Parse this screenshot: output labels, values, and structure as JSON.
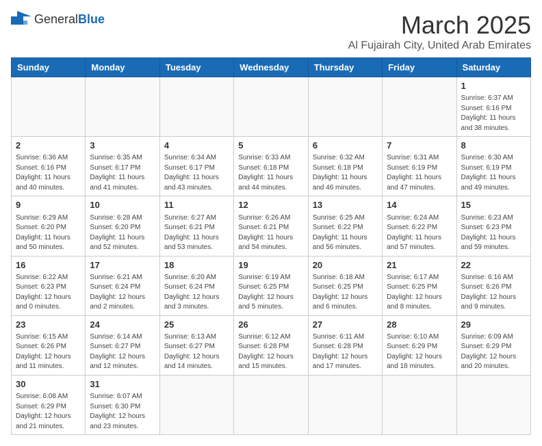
{
  "header": {
    "logo_general": "General",
    "logo_blue": "Blue",
    "title": "March 2025",
    "subtitle": "Al Fujairah City, United Arab Emirates"
  },
  "weekdays": [
    "Sunday",
    "Monday",
    "Tuesday",
    "Wednesday",
    "Thursday",
    "Friday",
    "Saturday"
  ],
  "weeks": [
    [
      {
        "day": "",
        "info": ""
      },
      {
        "day": "",
        "info": ""
      },
      {
        "day": "",
        "info": ""
      },
      {
        "day": "",
        "info": ""
      },
      {
        "day": "",
        "info": ""
      },
      {
        "day": "",
        "info": ""
      },
      {
        "day": "1",
        "info": "Sunrise: 6:37 AM\nSunset: 6:16 PM\nDaylight: 11 hours\nand 38 minutes."
      }
    ],
    [
      {
        "day": "2",
        "info": "Sunrise: 6:36 AM\nSunset: 6:16 PM\nDaylight: 11 hours\nand 40 minutes."
      },
      {
        "day": "3",
        "info": "Sunrise: 6:35 AM\nSunset: 6:17 PM\nDaylight: 11 hours\nand 41 minutes."
      },
      {
        "day": "4",
        "info": "Sunrise: 6:34 AM\nSunset: 6:17 PM\nDaylight: 11 hours\nand 43 minutes."
      },
      {
        "day": "5",
        "info": "Sunrise: 6:33 AM\nSunset: 6:18 PM\nDaylight: 11 hours\nand 44 minutes."
      },
      {
        "day": "6",
        "info": "Sunrise: 6:32 AM\nSunset: 6:18 PM\nDaylight: 11 hours\nand 46 minutes."
      },
      {
        "day": "7",
        "info": "Sunrise: 6:31 AM\nSunset: 6:19 PM\nDaylight: 11 hours\nand 47 minutes."
      },
      {
        "day": "8",
        "info": "Sunrise: 6:30 AM\nSunset: 6:19 PM\nDaylight: 11 hours\nand 49 minutes."
      }
    ],
    [
      {
        "day": "9",
        "info": "Sunrise: 6:29 AM\nSunset: 6:20 PM\nDaylight: 11 hours\nand 50 minutes."
      },
      {
        "day": "10",
        "info": "Sunrise: 6:28 AM\nSunset: 6:20 PM\nDaylight: 11 hours\nand 52 minutes."
      },
      {
        "day": "11",
        "info": "Sunrise: 6:27 AM\nSunset: 6:21 PM\nDaylight: 11 hours\nand 53 minutes."
      },
      {
        "day": "12",
        "info": "Sunrise: 6:26 AM\nSunset: 6:21 PM\nDaylight: 11 hours\nand 54 minutes."
      },
      {
        "day": "13",
        "info": "Sunrise: 6:25 AM\nSunset: 6:22 PM\nDaylight: 11 hours\nand 56 minutes."
      },
      {
        "day": "14",
        "info": "Sunrise: 6:24 AM\nSunset: 6:22 PM\nDaylight: 11 hours\nand 57 minutes."
      },
      {
        "day": "15",
        "info": "Sunrise: 6:23 AM\nSunset: 6:23 PM\nDaylight: 11 hours\nand 59 minutes."
      }
    ],
    [
      {
        "day": "16",
        "info": "Sunrise: 6:22 AM\nSunset: 6:23 PM\nDaylight: 12 hours\nand 0 minutes."
      },
      {
        "day": "17",
        "info": "Sunrise: 6:21 AM\nSunset: 6:24 PM\nDaylight: 12 hours\nand 2 minutes."
      },
      {
        "day": "18",
        "info": "Sunrise: 6:20 AM\nSunset: 6:24 PM\nDaylight: 12 hours\nand 3 minutes."
      },
      {
        "day": "19",
        "info": "Sunrise: 6:19 AM\nSunset: 6:25 PM\nDaylight: 12 hours\nand 5 minutes."
      },
      {
        "day": "20",
        "info": "Sunrise: 6:18 AM\nSunset: 6:25 PM\nDaylight: 12 hours\nand 6 minutes."
      },
      {
        "day": "21",
        "info": "Sunrise: 6:17 AM\nSunset: 6:25 PM\nDaylight: 12 hours\nand 8 minutes."
      },
      {
        "day": "22",
        "info": "Sunrise: 6:16 AM\nSunset: 6:26 PM\nDaylight: 12 hours\nand 9 minutes."
      }
    ],
    [
      {
        "day": "23",
        "info": "Sunrise: 6:15 AM\nSunset: 6:26 PM\nDaylight: 12 hours\nand 11 minutes."
      },
      {
        "day": "24",
        "info": "Sunrise: 6:14 AM\nSunset: 6:27 PM\nDaylight: 12 hours\nand 12 minutes."
      },
      {
        "day": "25",
        "info": "Sunrise: 6:13 AM\nSunset: 6:27 PM\nDaylight: 12 hours\nand 14 minutes."
      },
      {
        "day": "26",
        "info": "Sunrise: 6:12 AM\nSunset: 6:28 PM\nDaylight: 12 hours\nand 15 minutes."
      },
      {
        "day": "27",
        "info": "Sunrise: 6:11 AM\nSunset: 6:28 PM\nDaylight: 12 hours\nand 17 minutes."
      },
      {
        "day": "28",
        "info": "Sunrise: 6:10 AM\nSunset: 6:29 PM\nDaylight: 12 hours\nand 18 minutes."
      },
      {
        "day": "29",
        "info": "Sunrise: 6:09 AM\nSunset: 6:29 PM\nDaylight: 12 hours\nand 20 minutes."
      }
    ],
    [
      {
        "day": "30",
        "info": "Sunrise: 6:08 AM\nSunset: 6:29 PM\nDaylight: 12 hours\nand 21 minutes."
      },
      {
        "day": "31",
        "info": "Sunrise: 6:07 AM\nSunset: 6:30 PM\nDaylight: 12 hours\nand 23 minutes."
      },
      {
        "day": "",
        "info": ""
      },
      {
        "day": "",
        "info": ""
      },
      {
        "day": "",
        "info": ""
      },
      {
        "day": "",
        "info": ""
      },
      {
        "day": "",
        "info": ""
      }
    ]
  ]
}
